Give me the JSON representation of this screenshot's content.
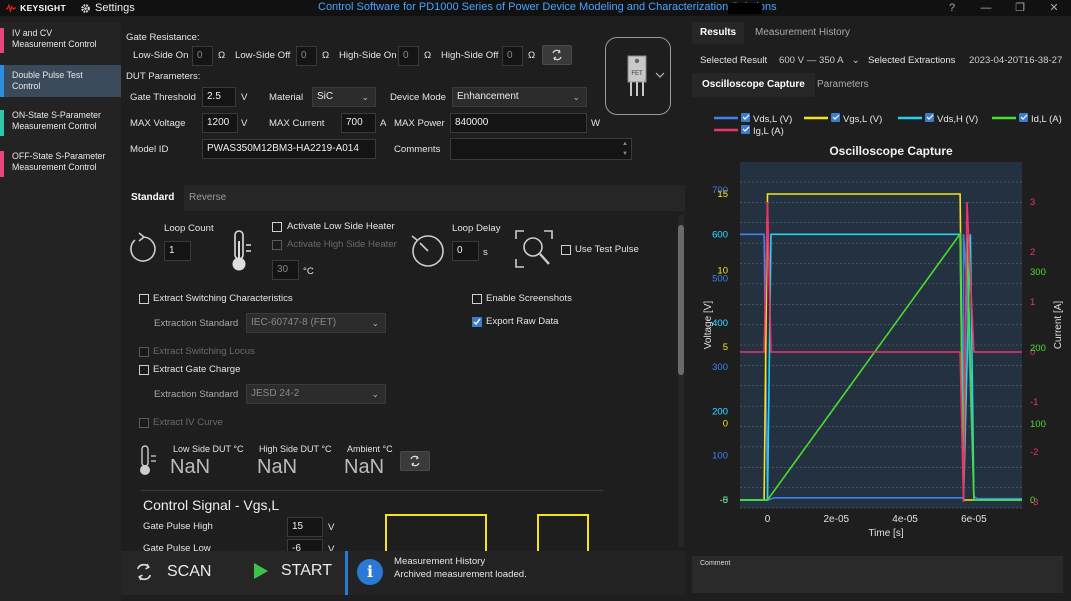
{
  "titlebar": {
    "logo": "KEYSIGHT",
    "settings": "Settings",
    "title": "Control Software for PD1000 Series of Power Device Modeling and Characterization Solutions",
    "help": "?",
    "minimize": "—",
    "restore": "❐",
    "close": "✕"
  },
  "nav": {
    "items": [
      {
        "label": "IV and CV\nMeasurement Control",
        "color": "#e8457a"
      },
      {
        "label": "Double Pulse Test\nControl",
        "color": "#2b8fe0"
      },
      {
        "label": "ON-State S-Parameter\nMeasurement Control",
        "color": "#2fc7a6"
      },
      {
        "label": "OFF-State S-Parameter\nMeasurement Control",
        "color": "#e8457a"
      }
    ]
  },
  "config": {
    "gate_resistance_label": "Gate Resistance:",
    "low_side_on_label": "Low-Side On",
    "low_side_on_value": "0",
    "low_side_off_label": "Low-Side Off",
    "low_side_off_value": "0",
    "high_side_on_label": "High-Side On",
    "high_side_on_value": "0",
    "high_side_off_label": "High-Side Off",
    "high_side_off_value": "0",
    "ohm": "Ω",
    "dut_params_label": "DUT Parameters:",
    "gate_threshold_label": "Gate Threshold",
    "gate_threshold_value": "2.5",
    "volt_unit": "V",
    "material_label": "Material",
    "material_value": "SiC",
    "device_mode_label": "Device Mode",
    "device_mode_value": "Enhancement",
    "max_voltage_label": "MAX Voltage",
    "max_voltage_value": "1200",
    "max_current_label": "MAX Current",
    "max_current_value": "700",
    "amp_unit": "A",
    "max_power_label": "MAX Power",
    "max_power_value": "840000",
    "watt_unit": "W",
    "model_id_label": "Model ID",
    "model_id_value": "PWAS350M12BM3-HA2219-A014",
    "comments_label": "Comments",
    "fet_label": "FET"
  },
  "tabs": {
    "standard": "Standard",
    "reverse": "Reverse"
  },
  "standard": {
    "loop_count_label": "Loop Count",
    "loop_count_value": "1",
    "activate_low_heater": "Activate Low Side Heater",
    "activate_high_heater": "Activate High Side Heater",
    "heater_temp_value": "30",
    "celsius": "°C",
    "loop_delay_label": "Loop Delay",
    "loop_delay_value": "0",
    "sec_unit": "s",
    "use_test_pulse": "Use Test Pulse",
    "extract_switching": "Extract Switching Characteristics",
    "extraction_standard_label": "Extraction Standard",
    "extraction_standard_1": "IEC-60747-8 (FET)",
    "enable_screenshots": "Enable Screenshots",
    "export_raw": "Export Raw Data",
    "extract_locus": "Extract Switching Locus",
    "extract_gate_charge": "Extract Gate Charge",
    "extraction_standard_2": "JESD 24-2",
    "extract_iv": "Extract IV Curve",
    "low_dut_label": "Low Side DUT °C",
    "high_dut_label": "High Side DUT °C",
    "ambient_label": "Ambient °C",
    "low_dut_value": "NaN",
    "high_dut_value": "NaN",
    "ambient_value": "NaN",
    "control_signal_title": "Control Signal - Vgs,L",
    "gate_pulse_high_label": "Gate Pulse High",
    "gate_pulse_high_value": "15",
    "gate_pulse_low_label": "Gate Pulse Low",
    "gate_pulse_low_value": "-6"
  },
  "bottom": {
    "scan": "SCAN",
    "start": "START",
    "msg_title": "Measurement History",
    "msg_body": "Archived measurement loaded."
  },
  "right": {
    "tab_results": "Results",
    "tab_history": "Measurement History",
    "selected_result_label": "Selected Result",
    "selected_result_value": "600 V — 350 A",
    "selected_extractions_label": "Selected Extractions",
    "selected_extractions_value": "2023-04-20T16-38-27",
    "tab_osc": "Oscilloscope Capture",
    "tab_params": "Parameters",
    "comment_label": "Comment"
  },
  "chart_data": {
    "type": "line",
    "title": "Oscilloscope Capture",
    "xlabel": "Time [s]",
    "ylabel_left": "Voltage [V]",
    "ylabel_right": "Current [A]",
    "xlim": [
      -8e-06,
      7.4e-05
    ],
    "x_ticks": [
      "0",
      "2e-05",
      "4e-05",
      "6e-05"
    ],
    "legend_position": "top",
    "legend": [
      {
        "name": "Vds,L (V)",
        "color": "#3b82f6"
      },
      {
        "name": "Vgs,L (V)",
        "color": "#f5e418"
      },
      {
        "name": "Vds,H (V)",
        "color": "#22d3ee"
      },
      {
        "name": "Id,L (A)",
        "color": "#4ade2c"
      },
      {
        "name": "Ig,L (A)",
        "color": "#f0326a"
      }
    ],
    "left_tick_groups": [
      {
        "color": "#3b82f6",
        "ticks": [
          "700",
          "600",
          "500",
          "400",
          "300",
          "200",
          "100",
          "0"
        ]
      },
      {
        "color": "#f5e418",
        "ticks": [
          "15",
          "10",
          "5",
          "0",
          "-5"
        ]
      },
      {
        "color": "#22d3ee",
        "ticks": [
          "600",
          "400",
          "200",
          "0"
        ]
      }
    ],
    "right_tick_groups": [
      {
        "color": "#f0326a",
        "ticks": [
          "3",
          "2",
          "1",
          "0",
          "-1",
          "-2",
          "-3"
        ]
      },
      {
        "color": "#4ade2c",
        "ticks": [
          "300",
          "200",
          "100",
          "0"
        ]
      }
    ],
    "series": [
      {
        "name": "Vds,L (V)",
        "color": "#3b82f6",
        "x": [
          -8e-06,
          -1e-06,
          0,
          2e-06,
          5.7e-05,
          5.7e-05,
          5.8e-05,
          6e-05,
          6.1e-05,
          7.4e-05
        ],
        "y": [
          600,
          600,
          0,
          5,
          5,
          600,
          480,
          8,
          3,
          3
        ]
      },
      {
        "name": "Vgs,L (V)",
        "color": "#f5e418",
        "x": [
          -8e-06,
          -1e-06,
          0,
          3e-06,
          5.6e-05,
          5.7e-05,
          6e-05,
          6.1e-05,
          7.4e-05
        ],
        "y": [
          -5,
          -5,
          15,
          15,
          15,
          -5,
          -5,
          -5,
          -5
        ]
      },
      {
        "name": "Vds,H (V)",
        "color": "#22d3ee",
        "x": [
          -8e-06,
          0,
          1e-06,
          5.6e-05,
          5.7e-05,
          5.9e-05,
          6e-05,
          7.4e-05
        ],
        "y": [
          0,
          0,
          600,
          600,
          0,
          600,
          0,
          0
        ]
      },
      {
        "name": "Id,L (A)",
        "color": "#4ade2c",
        "x": [
          -8e-06,
          0,
          5.6e-05,
          5.7e-05,
          5.8e-05,
          6e-05,
          6.1e-05,
          7.4e-05
        ],
        "y": [
          0,
          0,
          350,
          0,
          350,
          0,
          0,
          0
        ]
      },
      {
        "name": "Ig,L (A)",
        "color": "#f0326a",
        "x": [
          -8e-06,
          -1e-06,
          0,
          1e-06,
          5.6e-05,
          5.7e-05,
          5.8e-05,
          6e-05,
          7.4e-05
        ],
        "y": [
          0,
          0,
          3,
          0,
          0,
          -3,
          3,
          0,
          0
        ]
      }
    ]
  }
}
